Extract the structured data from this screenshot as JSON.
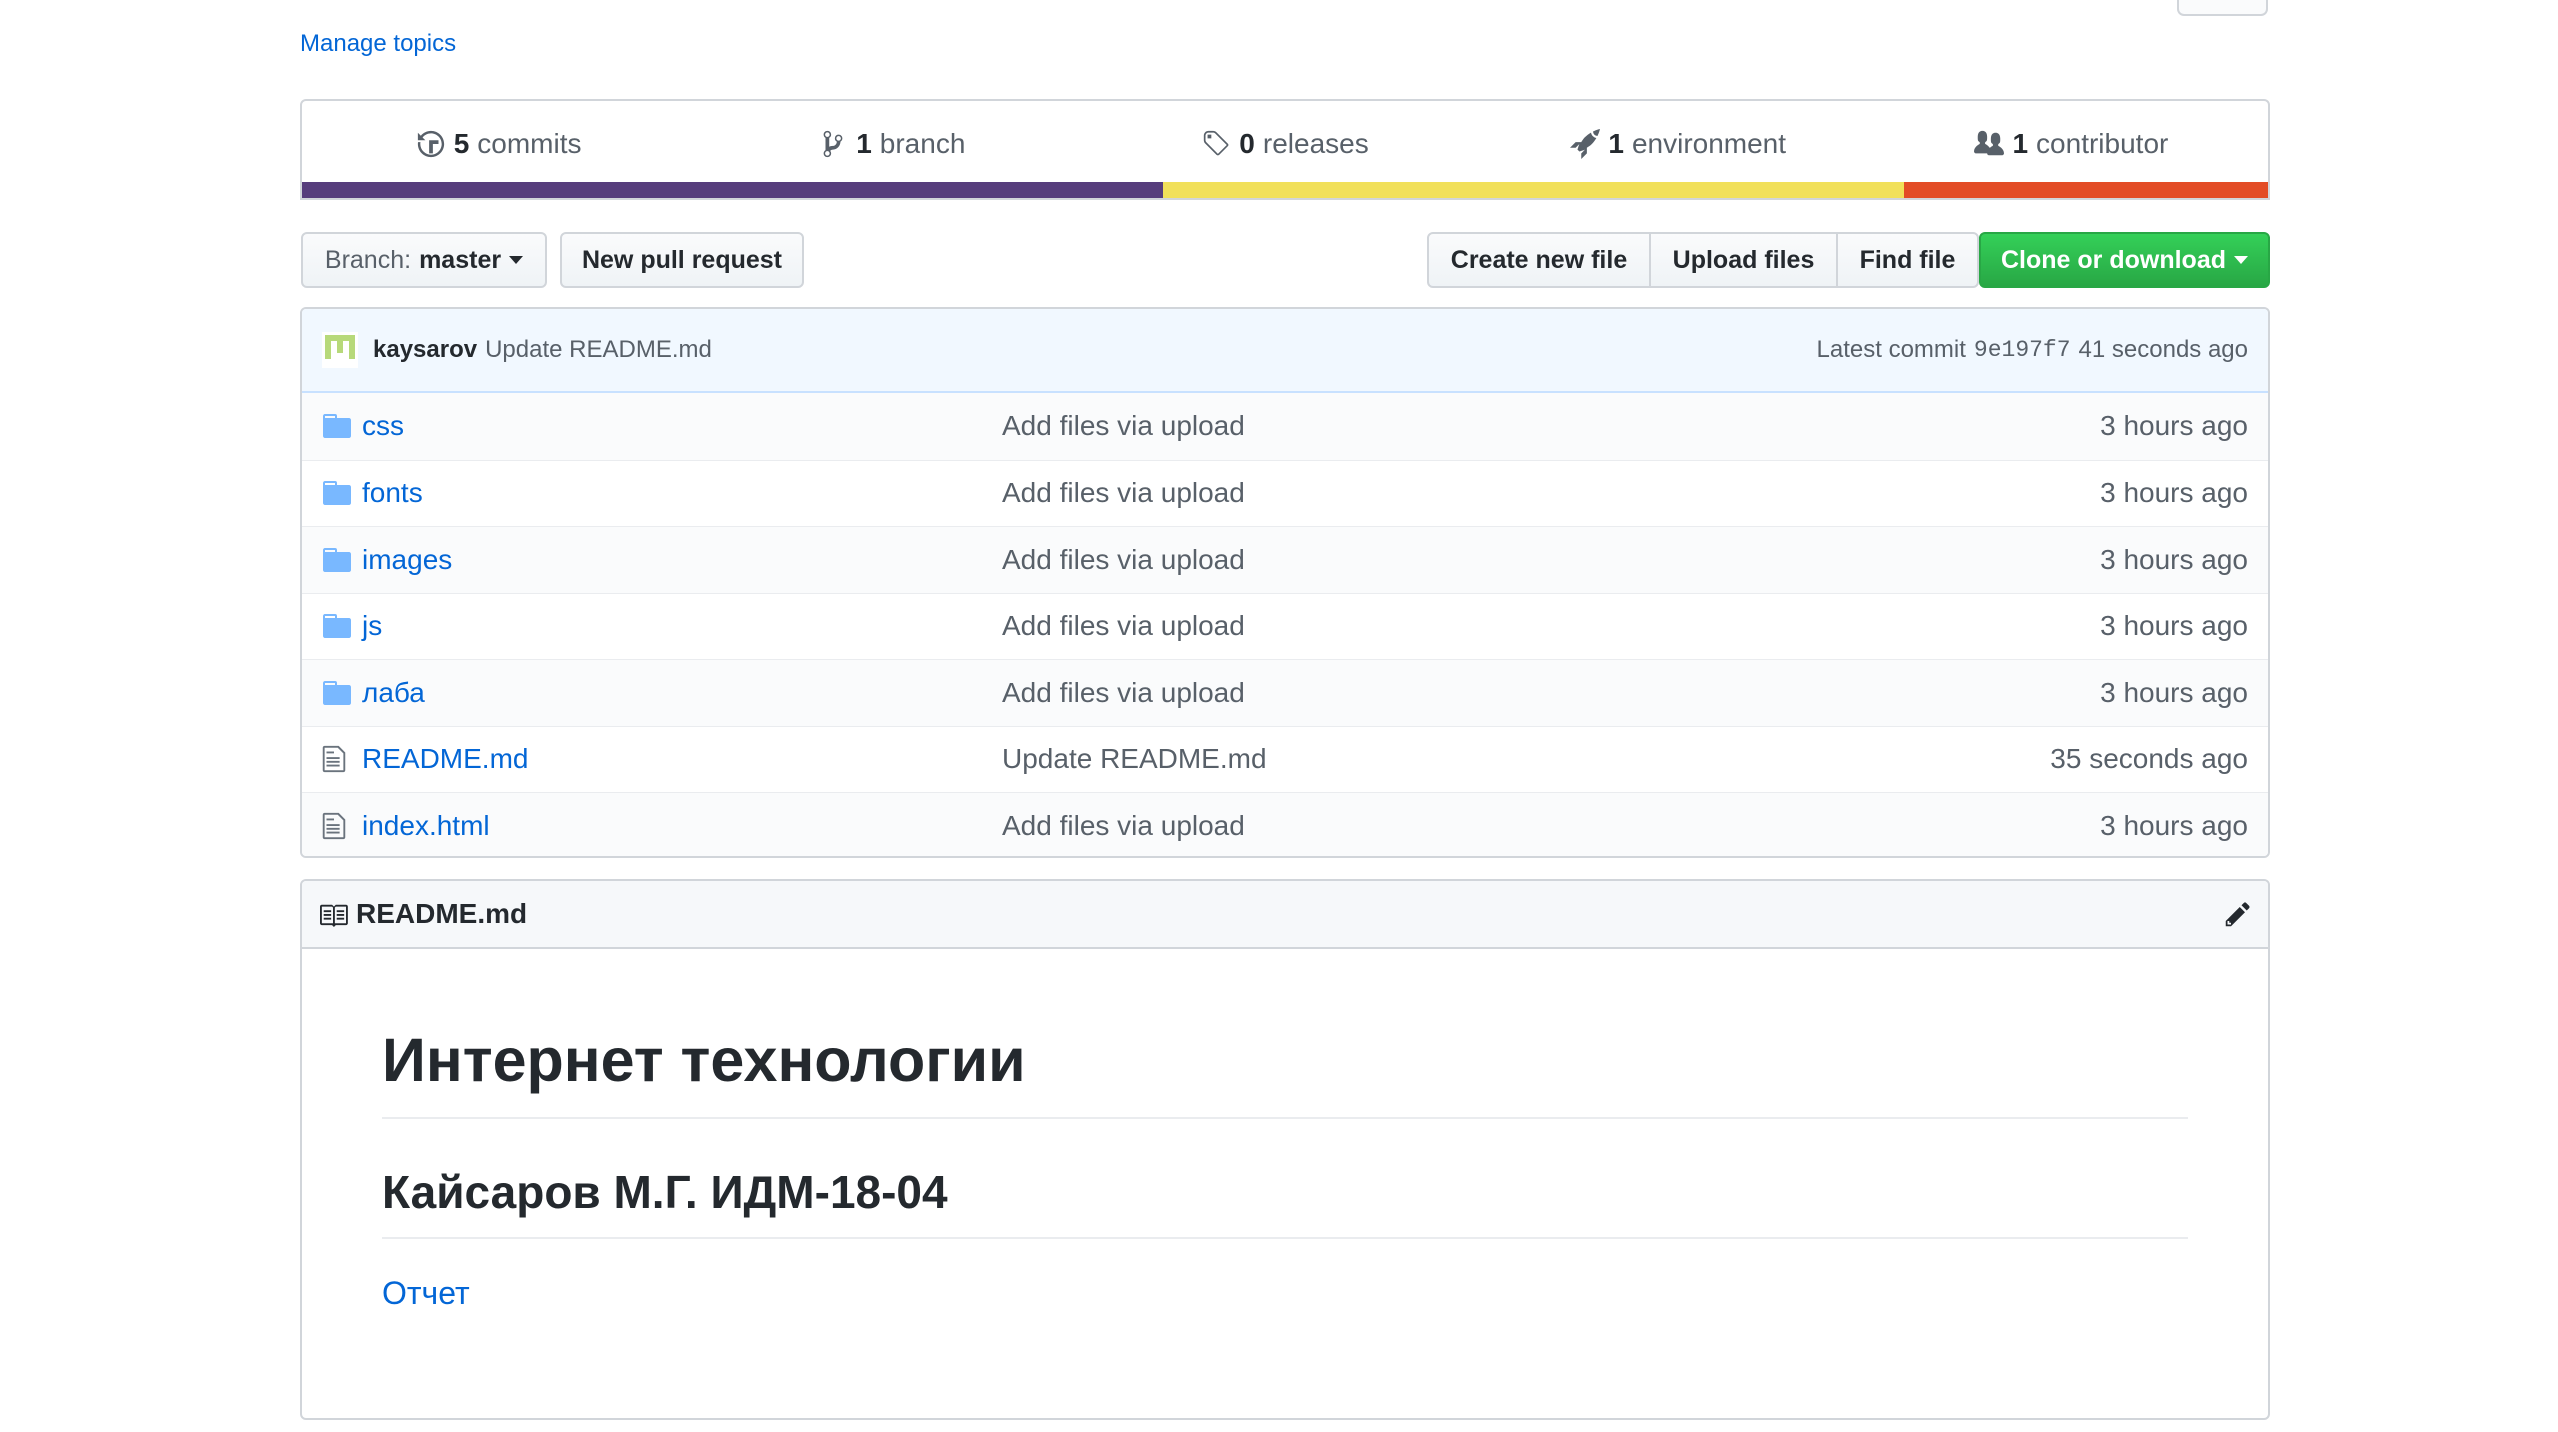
{
  "manage_topics": "Manage topics",
  "summary": [
    {
      "icon": "history-icon",
      "count": "5",
      "label": "commits"
    },
    {
      "icon": "git-branch-icon",
      "count": "1",
      "label": "branch"
    },
    {
      "icon": "tag-icon",
      "count": "0",
      "label": "releases"
    },
    {
      "icon": "rocket-icon",
      "count": "1",
      "label": "environment"
    },
    {
      "icon": "people-icon",
      "count": "1",
      "label": "contributor"
    }
  ],
  "languages": [
    {
      "color": "#563d7c",
      "share": 43.8
    },
    {
      "color": "#f1e05a",
      "share": 37.7
    },
    {
      "color": "#e34c26",
      "share": 18.5
    }
  ],
  "toolbar": {
    "branch_prefix": "Branch:",
    "branch_name": "master",
    "new_pr": "New pull request",
    "create_file": "Create new file",
    "upload_files": "Upload files",
    "find_file": "Find file",
    "clone": "Clone or download"
  },
  "latest_commit": {
    "author": "kaysarov",
    "message": "Update README.md",
    "prefix": "Latest commit",
    "sha": "9e197f7",
    "age": "41 seconds ago"
  },
  "files": [
    {
      "type": "dir",
      "name": "css",
      "message": "Add files via upload",
      "age": "3 hours ago"
    },
    {
      "type": "dir",
      "name": "fonts",
      "message": "Add files via upload",
      "age": "3 hours ago"
    },
    {
      "type": "dir",
      "name": "images",
      "message": "Add files via upload",
      "age": "3 hours ago"
    },
    {
      "type": "dir",
      "name": "js",
      "message": "Add files via upload",
      "age": "3 hours ago"
    },
    {
      "type": "dir",
      "name": "лаба",
      "message": "Add files via upload",
      "age": "3 hours ago"
    },
    {
      "type": "file",
      "name": "README.md",
      "message": "Update README.md",
      "age": "35 seconds ago"
    },
    {
      "type": "file",
      "name": "index.html",
      "message": "Add files via upload",
      "age": "3 hours ago"
    }
  ],
  "readme": {
    "filename": "README.md",
    "h1": "Интернет технологии",
    "h2": "Кайсаров М.Г. ИДМ-18-04",
    "link": "Отчет"
  },
  "colors": {
    "link": "#0366d6",
    "clone_green": "#28a745",
    "folder": "#79b8ff"
  }
}
